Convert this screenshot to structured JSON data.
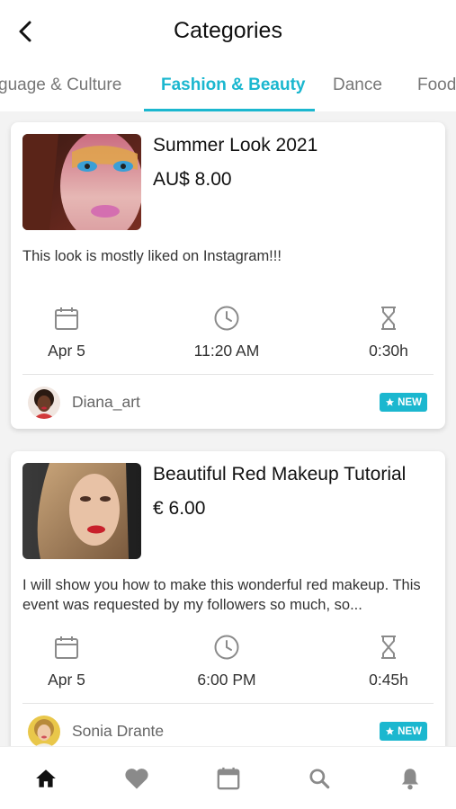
{
  "header": {
    "title": "Categories"
  },
  "tabs": [
    {
      "label": "guage & Culture",
      "active": false
    },
    {
      "label": "Fashion & Beauty",
      "active": true
    },
    {
      "label": "Dance",
      "active": false
    },
    {
      "label": "Food",
      "active": false
    }
  ],
  "events": [
    {
      "title": "Summer Look 2021",
      "price": "AU$ 8.00",
      "description": "This look is mostly liked on Instagram!!!",
      "date": "Apr 5",
      "time": "11:20 AM",
      "duration": "0:30h",
      "author": "Diana_art",
      "badge": "NEW"
    },
    {
      "title": "Beautiful Red Makeup Tutorial",
      "price": "€ 6.00",
      "description": "I will show you how to make this wonderful red makeup. This event was requested by my followers so much, so...",
      "date": "Apr 5",
      "time": "6:00 PM",
      "duration": "0:45h",
      "author": "Sonia Drante",
      "badge": "NEW"
    }
  ],
  "bottom_nav": [
    {
      "icon": "home-icon",
      "active": true
    },
    {
      "icon": "heart-icon",
      "active": false
    },
    {
      "icon": "calendar-icon",
      "active": false
    },
    {
      "icon": "search-icon",
      "active": false
    },
    {
      "icon": "bell-icon",
      "active": false
    }
  ],
  "colors": {
    "accent": "#1bb7cf",
    "icon_gray": "#8a8a8a",
    "nav_active": "#111111",
    "nav_inactive": "#8a8a8a"
  }
}
